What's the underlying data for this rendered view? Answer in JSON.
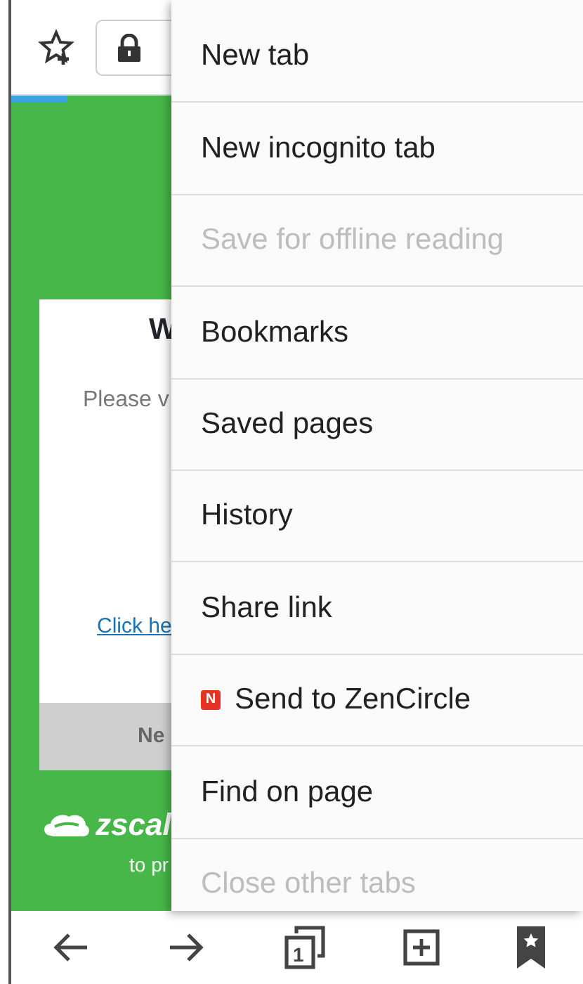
{
  "page": {
    "heading": "W",
    "message": "Please v",
    "link": "Click he",
    "footer_button": "Ne",
    "brand": "zscal",
    "tagline": "to pr"
  },
  "menu": [
    {
      "label": "New tab",
      "disabled": false
    },
    {
      "label": "New incognito tab",
      "disabled": false
    },
    {
      "label": "Save for offline reading",
      "disabled": true
    },
    {
      "label": "Bookmarks",
      "disabled": false
    },
    {
      "label": "Saved pages",
      "disabled": false
    },
    {
      "label": "History",
      "disabled": false
    },
    {
      "label": "Share link",
      "disabled": false
    },
    {
      "label": "Send to ZenCircle",
      "disabled": false,
      "badge": "N"
    },
    {
      "label": "Find on page",
      "disabled": false
    },
    {
      "label": "Close other tabs",
      "disabled": true
    }
  ],
  "bottom_bar": {
    "tab_count": "1"
  }
}
